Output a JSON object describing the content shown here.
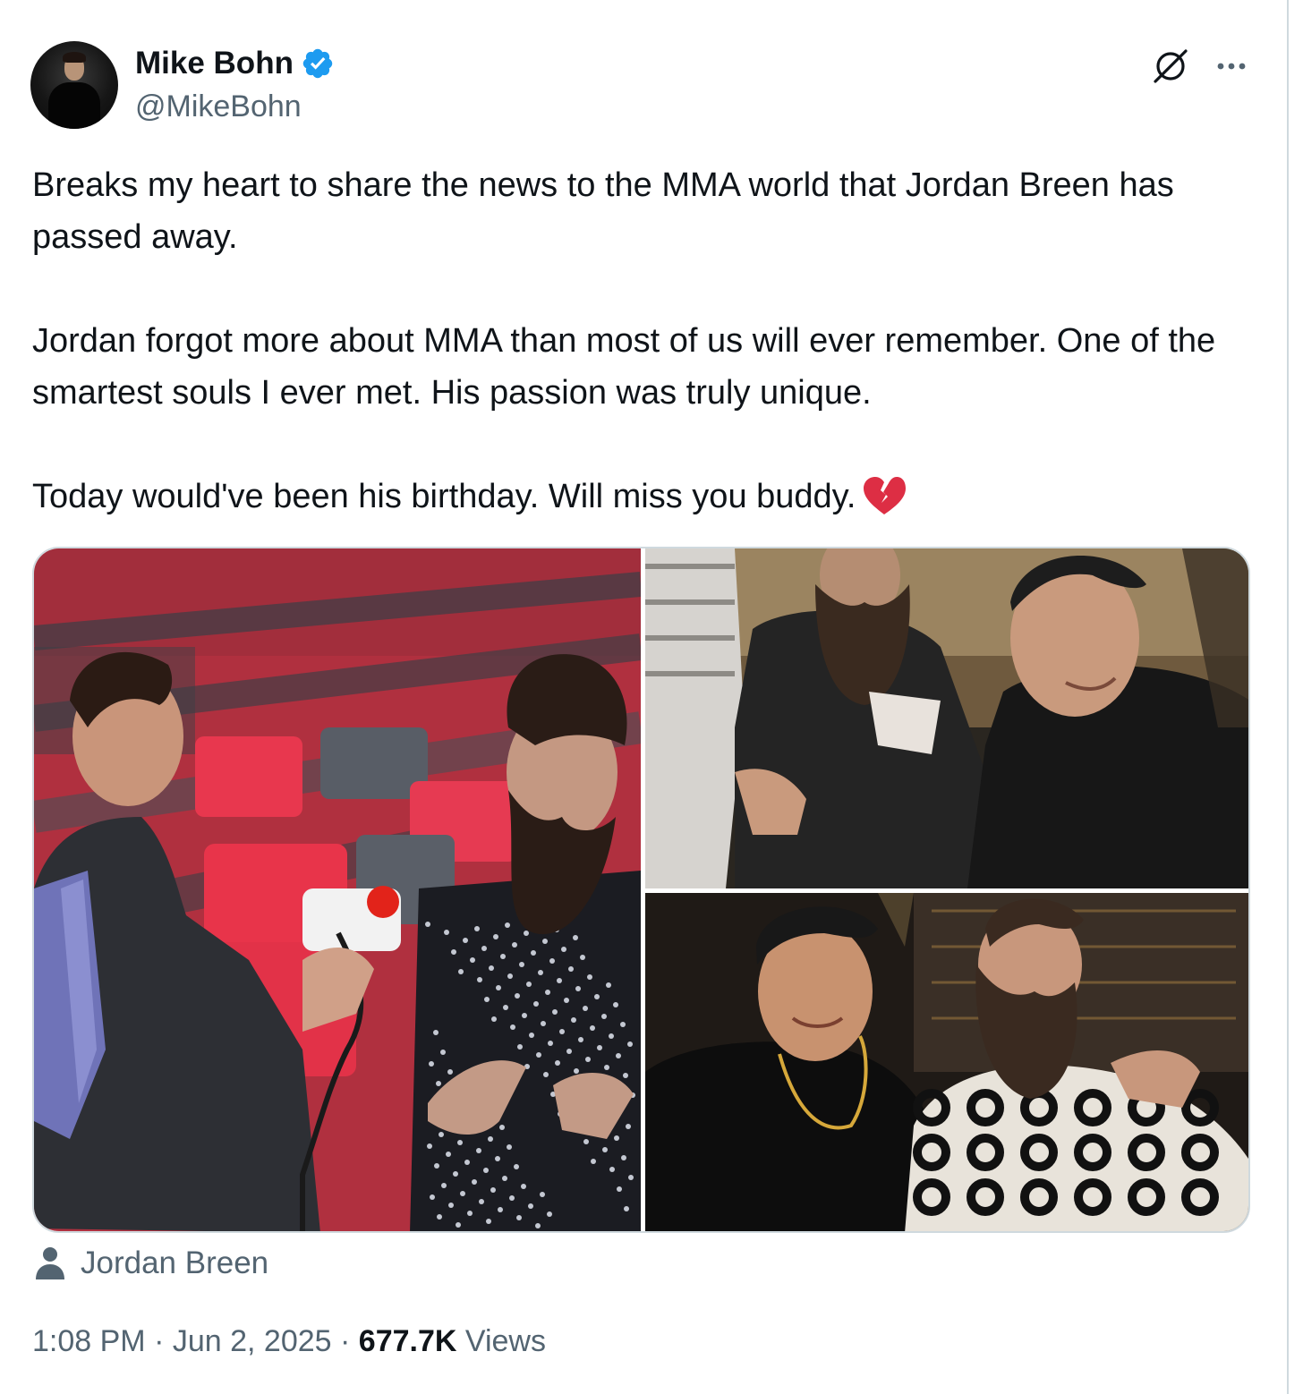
{
  "author": {
    "display_name": "Mike Bohn",
    "handle": "@MikeBohn",
    "verified": true,
    "verified_color": "#1d9bf0"
  },
  "header_icons": {
    "grok": "grok-icon",
    "more": "more-icon"
  },
  "tweet": {
    "paragraphs": [
      "Breaks my heart to share the news to the MMA world that Jordan Breen has passed away.",
      "Jordan forgot more about MMA than most of us will ever remember. One of the smartest souls I ever met. His passion was truly unique.",
      "Today would've been his birthday. Will miss you buddy."
    ],
    "trailing_emoji": "broken-heart-icon"
  },
  "media": {
    "photos": [
      {
        "id": "photo-interview",
        "description_icon": "photo"
      },
      {
        "id": "photo-group-seated",
        "description_icon": "photo"
      },
      {
        "id": "photo-two-friends",
        "description_icon": "photo"
      }
    ]
  },
  "tagged_user": {
    "icon": "person-icon",
    "name": "Jordan Breen"
  },
  "meta": {
    "time": "1:08 PM",
    "separator": "·",
    "date": "Jun 2, 2025",
    "views_count": "677.7K",
    "views_label": "Views"
  },
  "colors": {
    "text_primary": "#0f1419",
    "text_secondary": "#536471",
    "border": "#cfd9de",
    "heart": "#e0245e"
  }
}
